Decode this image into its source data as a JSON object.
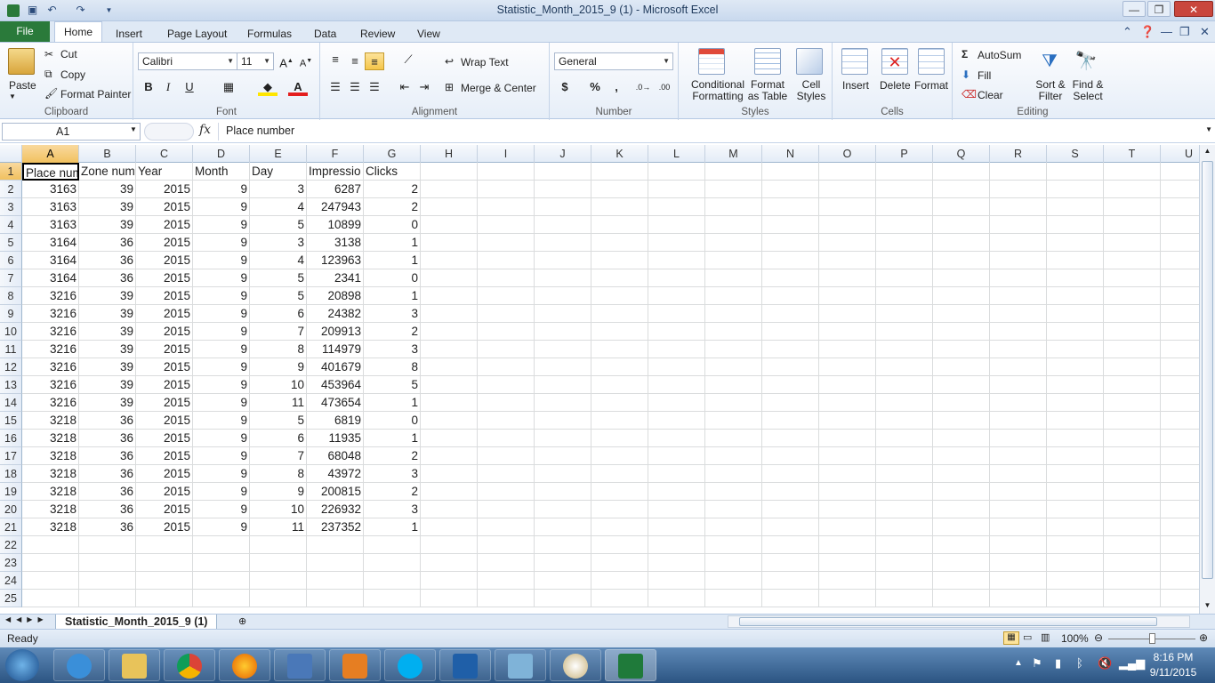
{
  "window": {
    "title": "Statistic_Month_2015_9 (1)  -  Microsoft Excel",
    "minimize": "—",
    "maximize": "❐",
    "close": "✕"
  },
  "tabs": {
    "file": "File",
    "items": [
      "Home",
      "Insert",
      "Page Layout",
      "Formulas",
      "Data",
      "Review",
      "View"
    ]
  },
  "ribbon": {
    "clipboard": {
      "paste": "Paste",
      "cut": "Cut",
      "copy": "Copy",
      "format_painter": "Format Painter",
      "label": "Clipboard"
    },
    "font": {
      "name": "Calibri",
      "size": "11",
      "bold": "B",
      "italic": "I",
      "underline": "U",
      "label": "Font"
    },
    "alignment": {
      "wrap": "Wrap Text",
      "merge": "Merge & Center",
      "label": "Alignment"
    },
    "number": {
      "format": "General",
      "dollar": "$",
      "percent": "%",
      "comma": ",",
      "label": "Number"
    },
    "styles": {
      "conditional": "Conditional Formatting",
      "format_table": "Format as Table",
      "cell_styles": "Cell Styles",
      "label": "Styles"
    },
    "cells": {
      "insert": "Insert",
      "delete": "Delete",
      "format": "Format",
      "label": "Cells"
    },
    "editing": {
      "autosum": "AutoSum",
      "fill": "Fill",
      "clear": "Clear",
      "sort": "Sort & Filter",
      "find": "Find & Select",
      "label": "Editing"
    }
  },
  "formula_bar": {
    "name_box": "A1",
    "fx": "fx",
    "content": "Place number"
  },
  "columns": [
    "A",
    "B",
    "C",
    "D",
    "E",
    "F",
    "G",
    "H",
    "I",
    "J",
    "K",
    "L",
    "M",
    "N",
    "O",
    "P",
    "Q",
    "R",
    "S",
    "T",
    "U"
  ],
  "header_row": [
    "Place num",
    "Zone num",
    "Year",
    "Month",
    "Day",
    "Impressio",
    "Clicks"
  ],
  "rows": [
    [
      "3163",
      "39",
      "2015",
      "9",
      "3",
      "6287",
      "2"
    ],
    [
      "3163",
      "39",
      "2015",
      "9",
      "4",
      "247943",
      "2"
    ],
    [
      "3163",
      "39",
      "2015",
      "9",
      "5",
      "10899",
      "0"
    ],
    [
      "3164",
      "36",
      "2015",
      "9",
      "3",
      "3138",
      "1"
    ],
    [
      "3164",
      "36",
      "2015",
      "9",
      "4",
      "123963",
      "1"
    ],
    [
      "3164",
      "36",
      "2015",
      "9",
      "5",
      "2341",
      "0"
    ],
    [
      "3216",
      "39",
      "2015",
      "9",
      "5",
      "20898",
      "1"
    ],
    [
      "3216",
      "39",
      "2015",
      "9",
      "6",
      "24382",
      "3"
    ],
    [
      "3216",
      "39",
      "2015",
      "9",
      "7",
      "209913",
      "2"
    ],
    [
      "3216",
      "39",
      "2015",
      "9",
      "8",
      "114979",
      "3"
    ],
    [
      "3216",
      "39",
      "2015",
      "9",
      "9",
      "401679",
      "8"
    ],
    [
      "3216",
      "39",
      "2015",
      "9",
      "10",
      "453964",
      "5"
    ],
    [
      "3216",
      "39",
      "2015",
      "9",
      "11",
      "473654",
      "1"
    ],
    [
      "3218",
      "36",
      "2015",
      "9",
      "5",
      "6819",
      "0"
    ],
    [
      "3218",
      "36",
      "2015",
      "9",
      "6",
      "11935",
      "1"
    ],
    [
      "3218",
      "36",
      "2015",
      "9",
      "7",
      "68048",
      "2"
    ],
    [
      "3218",
      "36",
      "2015",
      "9",
      "8",
      "43972",
      "3"
    ],
    [
      "3218",
      "36",
      "2015",
      "9",
      "9",
      "200815",
      "2"
    ],
    [
      "3218",
      "36",
      "2015",
      "9",
      "10",
      "226932",
      "3"
    ],
    [
      "3218",
      "36",
      "2015",
      "9",
      "11",
      "237352",
      "1"
    ]
  ],
  "row_numbers": [
    "1",
    "2",
    "3",
    "4",
    "5",
    "6",
    "7",
    "8",
    "9",
    "10",
    "11",
    "12",
    "13",
    "14",
    "15",
    "16",
    "17",
    "18",
    "19",
    "20",
    "21",
    "22",
    "23",
    "24",
    "25"
  ],
  "sheet_tab": "Statistic_Month_2015_9 (1)",
  "status": {
    "ready": "Ready",
    "zoom": "100%"
  },
  "clock": {
    "time": "8:16 PM",
    "date": "9/11/2015"
  },
  "colors": {
    "file_tab": "#2a7a3a",
    "selection": "#f1c15f",
    "taskbar": "#2b5482"
  }
}
